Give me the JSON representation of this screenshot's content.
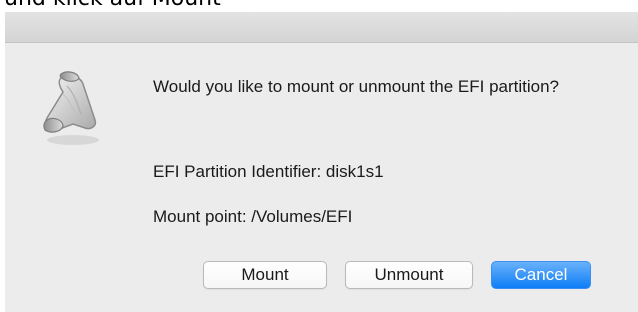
{
  "page_caption": "und klick auf Mount",
  "dialog": {
    "icon": "script-scroll-icon",
    "message": "Would you like to mount or unmount the EFI partition?",
    "identifier_line": "EFI Partition Identifier: disk1s1",
    "mount_point_line": "Mount point: /Volumes/EFI",
    "buttons": {
      "mount": "Mount",
      "unmount": "Unmount",
      "cancel": "Cancel"
    }
  },
  "colors": {
    "dialog_background": "#ececec",
    "default_button": "#1a84f7",
    "text": "#1a1a1a"
  }
}
